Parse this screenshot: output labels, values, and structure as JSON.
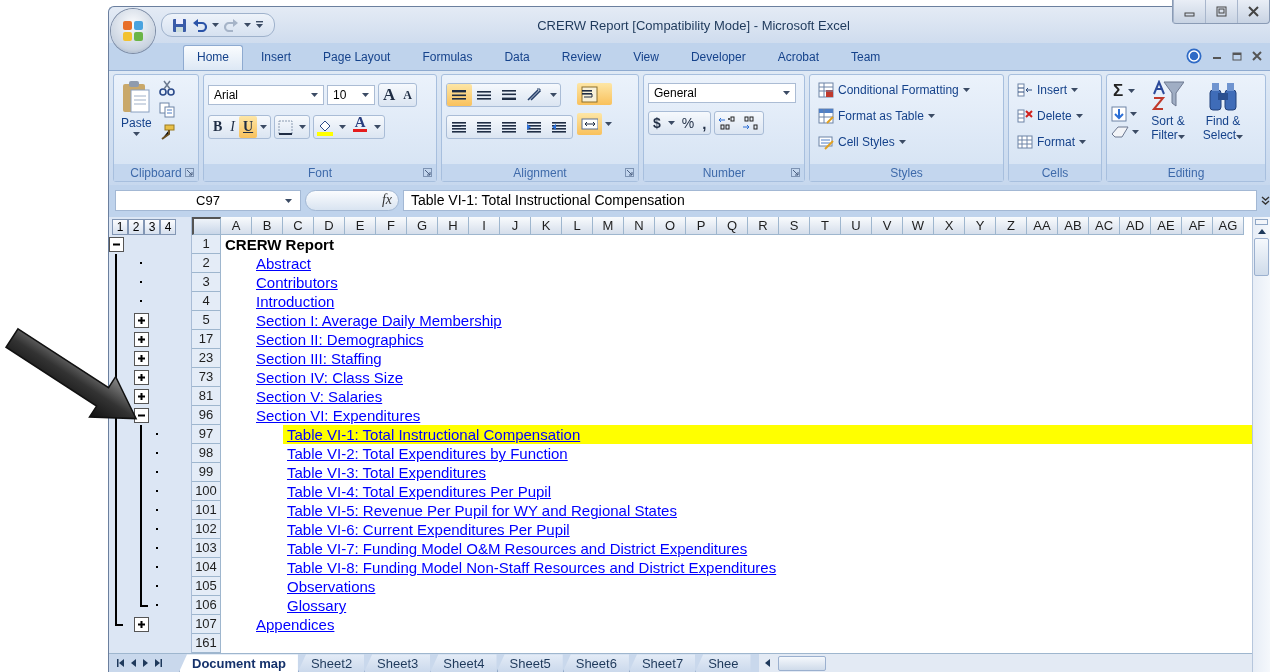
{
  "window": {
    "title": "CRERW Report  [Compatibility Mode] - Microsoft Excel"
  },
  "tabs": [
    {
      "label": "Home",
      "selected": true
    },
    {
      "label": "Insert",
      "selected": false
    },
    {
      "label": "Page Layout",
      "selected": false
    },
    {
      "label": "Formulas",
      "selected": false
    },
    {
      "label": "Data",
      "selected": false
    },
    {
      "label": "Review",
      "selected": false
    },
    {
      "label": "View",
      "selected": false
    },
    {
      "label": "Developer",
      "selected": false
    },
    {
      "label": "Acrobat",
      "selected": false
    },
    {
      "label": "Team",
      "selected": false
    }
  ],
  "ribbon": {
    "clipboard": {
      "label": "Clipboard",
      "paste": "Paste"
    },
    "font": {
      "label": "Font",
      "font_name": "Arial",
      "font_size": "10",
      "grow": "A",
      "shrink": "A",
      "bold": {
        "text": "B",
        "selected": false
      },
      "italic": {
        "text": "I",
        "selected": false
      },
      "underline": {
        "text": "U",
        "selected": true
      },
      "font_color": "A"
    },
    "alignment": {
      "label": "Alignment",
      "buttons": [
        {
          "kind": "top",
          "selected": true
        },
        {
          "kind": "middle",
          "selected": false
        },
        {
          "kind": "bottom",
          "selected": false
        },
        {
          "kind": "orientation",
          "selected": false
        },
        {
          "kind": "wrap",
          "selected": true
        },
        {
          "kind": "left",
          "selected": false
        },
        {
          "kind": "center",
          "selected": false
        },
        {
          "kind": "right",
          "selected": false
        },
        {
          "kind": "outdent",
          "selected": false
        },
        {
          "kind": "indent",
          "selected": false
        },
        {
          "kind": "merge",
          "selected": true
        }
      ]
    },
    "number": {
      "label": "Number",
      "format": "General",
      "currency": "$",
      "percent": "%",
      "comma": ","
    },
    "styles": {
      "label": "Styles",
      "items": [
        "Conditional Formatting",
        "Format as Table",
        "Cell Styles"
      ]
    },
    "cells": {
      "label": "Cells",
      "items": [
        "Insert",
        "Delete",
        "Format"
      ]
    },
    "editing": {
      "label": "Editing",
      "sum": "Σ",
      "sort": "Sort & Filter",
      "find": "Find & Select"
    }
  },
  "formula_bar": {
    "name_box": "C97",
    "function_label": "fx",
    "formula": "Table VI-1: Total Instructional Compensation"
  },
  "outline_levels": [
    "1",
    "2",
    "3",
    "4"
  ],
  "columns": [
    "A",
    "B",
    "C",
    "D",
    "E",
    "F",
    "G",
    "H",
    "I",
    "J",
    "K",
    "L",
    "M",
    "N",
    "O",
    "P",
    "Q",
    "R",
    "S",
    "T",
    "U",
    "V",
    "W",
    "X",
    "Y",
    "Z",
    "AA",
    "AB",
    "AC",
    "AD",
    "AE",
    "AF",
    "AG"
  ],
  "rows": [
    {
      "row": "1",
      "kind": "title",
      "text": "CRERW Report",
      "expanded": true,
      "selected": false,
      "children": [
        {
          "row": "2",
          "kind": "link",
          "text": "Abstract",
          "selected": false
        },
        {
          "row": "3",
          "kind": "link",
          "text": "Contributors",
          "selected": false
        },
        {
          "row": "4",
          "kind": "link",
          "text": "Introduction",
          "selected": false
        },
        {
          "row": "5",
          "kind": "link",
          "text": "Section I: Average Daily Membership",
          "expanded": false,
          "selected": false
        },
        {
          "row": "17",
          "kind": "link",
          "text": "Section II: Demographics",
          "expanded": false,
          "selected": false
        },
        {
          "row": "23",
          "kind": "link",
          "text": "Section III: Staffing",
          "expanded": false,
          "selected": false
        },
        {
          "row": "73",
          "kind": "link",
          "text": "Section IV: Class Size",
          "expanded": false,
          "selected": false
        },
        {
          "row": "81",
          "kind": "link",
          "text": "Section V: Salaries",
          "expanded": false,
          "selected": false
        },
        {
          "row": "96",
          "kind": "link",
          "text": "Section VI: Expenditures",
          "expanded": true,
          "selected": false,
          "children": [
            {
              "row": "97",
              "kind": "link",
              "text": "Table VI-1: Total Instructional Compensation",
              "selected": true
            },
            {
              "row": "98",
              "kind": "link",
              "text": "Table VI-2: Total Expenditures by Function",
              "selected": false
            },
            {
              "row": "99",
              "kind": "link",
              "text": "Table VI-3: Total Expenditures",
              "selected": false
            },
            {
              "row": "100",
              "kind": "link",
              "text": "Table VI-4: Total Expenditures Per Pupil",
              "selected": false
            },
            {
              "row": "101",
              "kind": "link",
              "text": "Table VI-5: Revenue Per Pupil for WY and Regional States",
              "selected": false
            },
            {
              "row": "102",
              "kind": "link",
              "text": "Table VI-6: Current Expenditures Per Pupil",
              "selected": false
            },
            {
              "row": "103",
              "kind": "link",
              "text": "Table VI-7: Funding Model O&M Resources and District Expenditures",
              "selected": false
            },
            {
              "row": "104",
              "kind": "link",
              "text": "Table VI-8: Funding Model Non-Staff Resources and District Expenditures",
              "selected": false
            },
            {
              "row": "105",
              "kind": "link",
              "text": "Observations",
              "selected": false
            },
            {
              "row": "106",
              "kind": "link",
              "text": "Glossary",
              "selected": false
            }
          ]
        },
        {
          "row": "107",
          "kind": "link",
          "text": "Appendices",
          "expanded": false,
          "selected": false
        }
      ]
    },
    {
      "row": "161",
      "selected": false
    }
  ],
  "sheet_tabs": [
    {
      "label": "Document map",
      "selected": true
    },
    {
      "label": "Sheet2",
      "selected": false
    },
    {
      "label": "Sheet3",
      "selected": false
    },
    {
      "label": "Sheet4",
      "selected": false
    },
    {
      "label": "Sheet5",
      "selected": false
    },
    {
      "label": "Sheet6",
      "selected": false
    },
    {
      "label": "Sheet7",
      "selected": false
    },
    {
      "label": "Shee",
      "selected": false
    }
  ]
}
